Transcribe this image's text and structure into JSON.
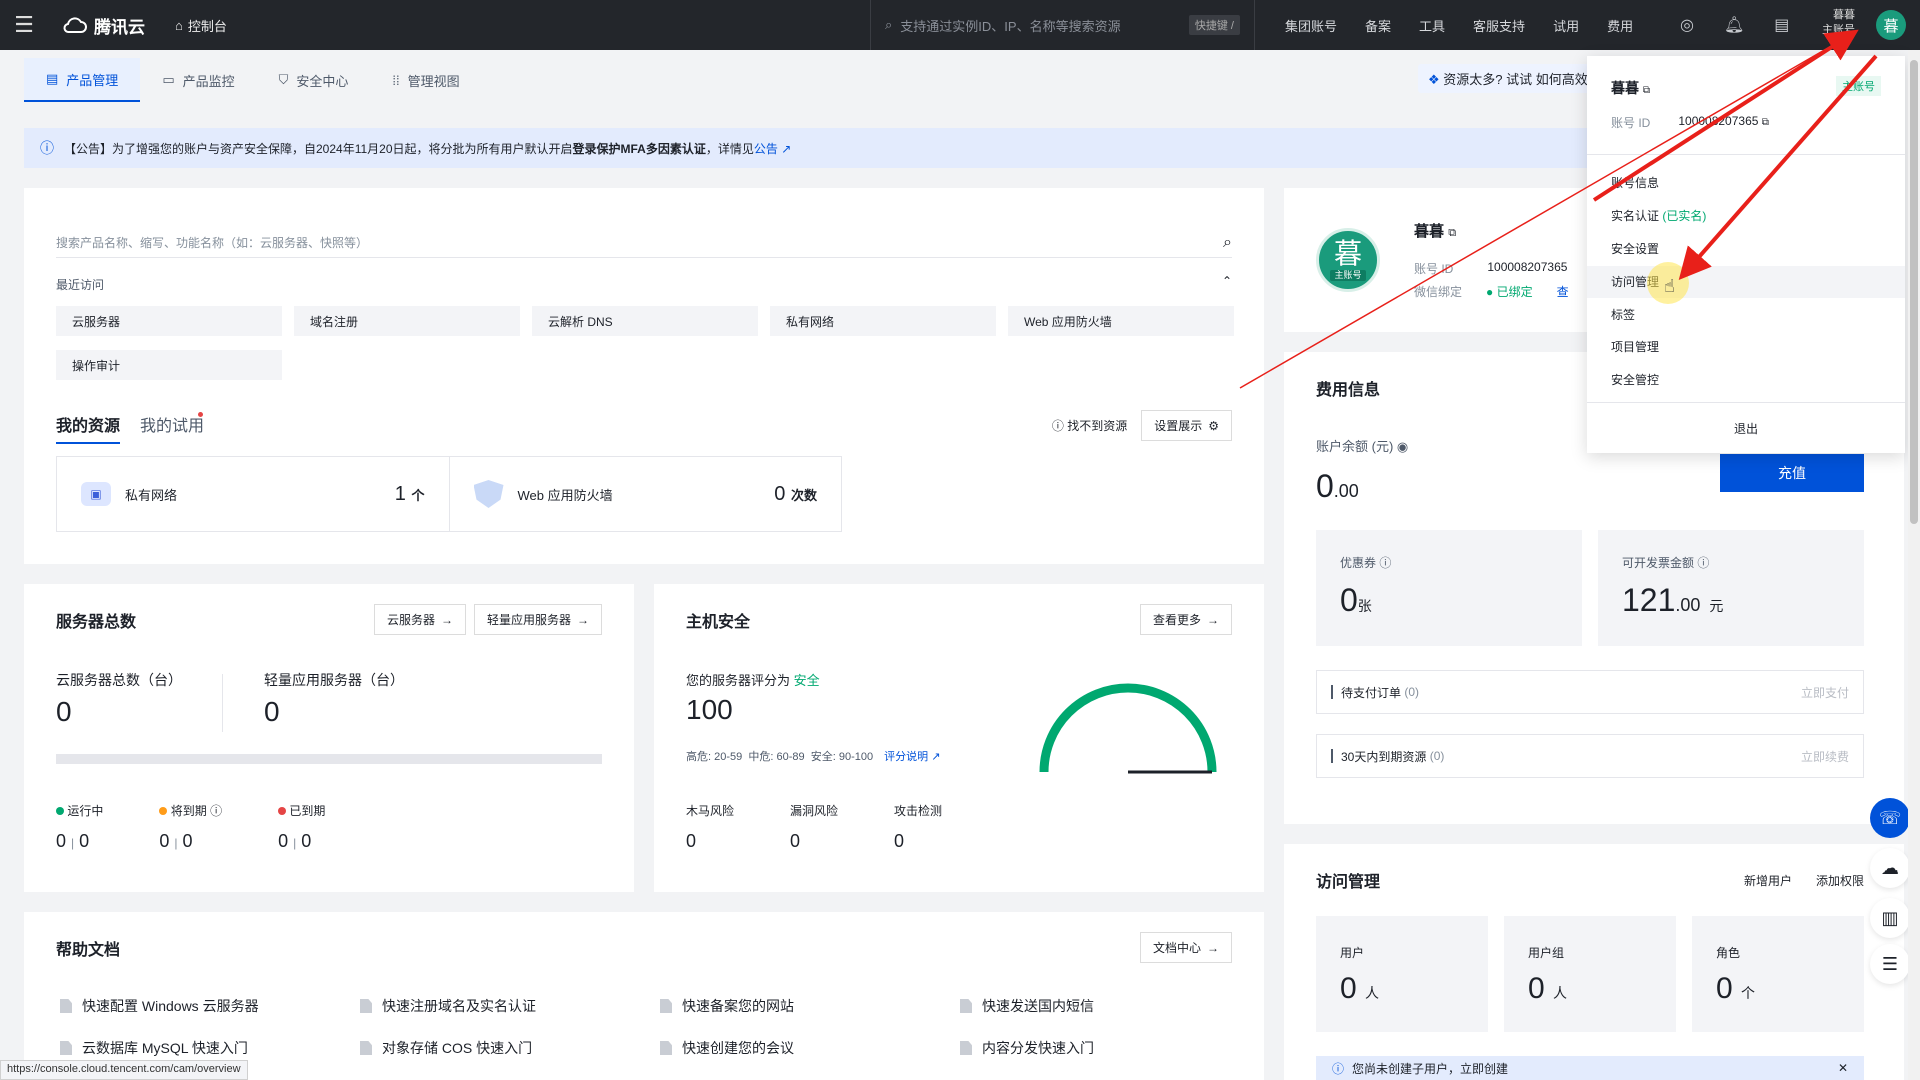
{
  "topbar": {
    "logo": "腾讯云",
    "console": "控制台",
    "search_placeholder": "支持通过实例ID、IP、名称等搜索资源",
    "shortcut": "快捷键 /",
    "nav": [
      "集团账号",
      "备案",
      "工具",
      "客服支持",
      "试用",
      "费用"
    ],
    "user_name": "暮暮",
    "user_role": "主账号",
    "avatar_char": "暮"
  },
  "tabs": [
    {
      "label": "产品管理"
    },
    {
      "label": "产品监控"
    },
    {
      "label": "安全中心"
    },
    {
      "label": "管理视图"
    }
  ],
  "tip_banner": "资源太多? 试试 如何高效管理",
  "notice": {
    "prefix": "【公告】为了增强您的账户与资产安全保障，自2024年11月20日起，将分批为所有用户默认开启",
    "bold": "登录保护MFA多因素认证",
    "suffix": "，详情见",
    "link": "公告"
  },
  "products": {
    "search_placeholder": "搜索产品名称、缩写、功能名称（如：云服务器、快照等）",
    "recent_label": "最近访问",
    "recent": [
      "云服务器",
      "域名注册",
      "云解析 DNS",
      "私有网络",
      "Web 应用防火墙",
      "操作审计"
    ],
    "tab_mine": "我的资源",
    "tab_trial": "我的试用",
    "cant_find": "找不到资源",
    "settings": "设置展示",
    "resources": [
      {
        "name": "私有网络",
        "count": "1",
        "unit": "个"
      },
      {
        "name": "Web 应用防火墙",
        "count": "0",
        "unit": "次数"
      }
    ]
  },
  "profile": {
    "name": "暮暮",
    "avatar_char": "暮",
    "avatar_tag": "主账号",
    "account_id_label": "账号 ID",
    "account_id": "100008207365",
    "wechat_label": "微信绑定",
    "wechat_status": "已绑定",
    "wechat_more": "查"
  },
  "servers": {
    "title": "服务器总数",
    "btn_cvm": "云服务器",
    "btn_light": "轻量应用服务器",
    "cvm_label": "云服务器总数（台）",
    "cvm_value": "0",
    "light_label": "轻量应用服务器（台）",
    "light_value": "0",
    "statuses": [
      {
        "label": "运行中",
        "color": "#00a870",
        "a": "0",
        "b": "0"
      },
      {
        "label": "将到期",
        "color": "#ff9c19",
        "a": "0",
        "b": "0"
      },
      {
        "label": "已到期",
        "color": "#e54545",
        "a": "0",
        "b": "0"
      }
    ]
  },
  "security": {
    "title": "主机安全",
    "more": "查看更多",
    "score_text": "您的服务器评分为",
    "score_status": "安全",
    "score": "100",
    "ranges": "高危: 20-59  中危: 60-89  安全: 90-100",
    "explain": "评分说明",
    "risks": [
      {
        "label": "木马风险",
        "value": "0"
      },
      {
        "label": "漏洞风险",
        "value": "0"
      },
      {
        "label": "攻击检测",
        "value": "0"
      }
    ],
    "gauge_color": "#00a870"
  },
  "billing": {
    "title": "费用信息",
    "balance_label": "账户余额 (元)",
    "balance_int": "0",
    "balance_dec": ".00",
    "recharge": "充值",
    "coupon_label": "优惠券",
    "coupon_value": "0",
    "coupon_unit": "张",
    "invoice_label": "可开发票金额",
    "invoice_int": "121",
    "invoice_dec": ".00",
    "invoice_unit": "元",
    "pending_label": "待支付订单",
    "pending_count": "(0)",
    "pending_action": "立即支付",
    "expiring_label": "30天内到期资源",
    "expiring_count": "(0)",
    "expiring_action": "立即续费"
  },
  "cam": {
    "title": "访问管理",
    "new_user": "新增用户",
    "add_perm": "添加权限",
    "boxes": [
      {
        "label": "用户",
        "value": "0",
        "unit": "人"
      },
      {
        "label": "用户组",
        "value": "0",
        "unit": "人"
      },
      {
        "label": "角色",
        "value": "0",
        "unit": "个"
      }
    ],
    "hint": "您尚未创建子用户，立即创建"
  },
  "docs": {
    "title": "帮助文档",
    "center": "文档中心",
    "items": [
      "快速配置 Windows 云服务器",
      "快速注册域名及实名认证",
      "快速备案您的网站",
      "快速发送国内短信",
      "云数据库 MySQL 快速入门",
      "对象存储 COS 快速入门",
      "快速创建您的会议",
      "内容分发快速入门"
    ]
  },
  "dropdown": {
    "name": "暮暮",
    "badge": "主账号",
    "id_label": "账号 ID",
    "id_value": "100008207365",
    "items": [
      "账号信息",
      "实名认证",
      "安全设置",
      "访问管理",
      "标签",
      "项目管理",
      "安全管控"
    ],
    "verified": "(已实名)",
    "logout": "退出"
  },
  "statusbar": "https://console.cloud.tencent.com/cam/overview",
  "colors": {
    "primary": "#0052d9",
    "success": "#00a870",
    "arrow": "#e8201a"
  }
}
